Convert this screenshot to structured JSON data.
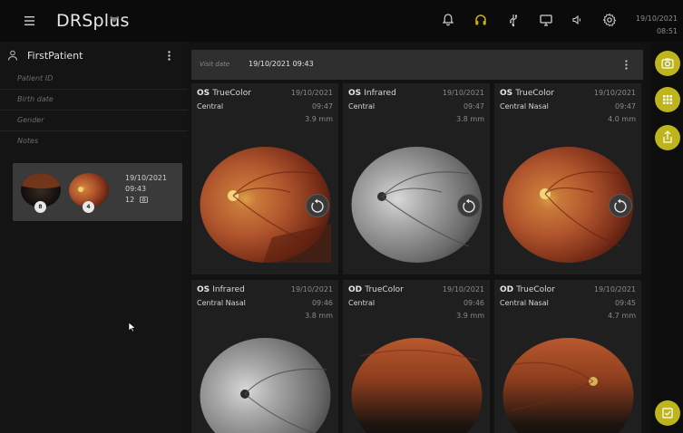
{
  "app": {
    "title": "DRSplus"
  },
  "topbar": {
    "date": "19/10/2021",
    "time": "08:51"
  },
  "patient": {
    "name": "FirstPatient",
    "fields": [
      "Patient ID",
      "Birth date",
      "Gender",
      "Notes"
    ]
  },
  "visit_card": {
    "date": "19/10/2021",
    "time": "09:43",
    "count": "12",
    "badge_left": "8",
    "badge_right": "4"
  },
  "visit_bar": {
    "label": "Visit date",
    "value": "19/10/2021 09:43"
  },
  "cards": [
    {
      "eye": "OS",
      "mode": "TrueColor",
      "region": "Central",
      "date": "19/10/2021",
      "time": "09:47",
      "size": "3.9 mm",
      "kind": "color"
    },
    {
      "eye": "OS",
      "mode": "Infrared",
      "region": "Central",
      "date": "19/10/2021",
      "time": "09:47",
      "size": "3.8 mm",
      "kind": "ir"
    },
    {
      "eye": "OS",
      "mode": "TrueColor",
      "region": "Central Nasal",
      "date": "19/10/2021",
      "time": "09:47",
      "size": "4.0 mm",
      "kind": "color"
    },
    {
      "eye": "OS",
      "mode": "Infrared",
      "region": "Central Nasal",
      "date": "19/10/2021",
      "time": "09:46",
      "size": "3.8 mm",
      "kind": "ir"
    },
    {
      "eye": "OD",
      "mode": "TrueColor",
      "region": "Central",
      "date": "19/10/2021",
      "time": "09:46",
      "size": "3.9 mm",
      "kind": "color-dark"
    },
    {
      "eye": "OD",
      "mode": "TrueColor",
      "region": "Central Nasal",
      "date": "19/10/2021",
      "time": "09:45",
      "size": "4.7 mm",
      "kind": "color-dark"
    }
  ],
  "colors": {
    "accent": "#bdb51b",
    "headphone_active": "#d4b200"
  },
  "icons": [
    "menu-icon",
    "bell-icon",
    "headphones-icon",
    "usb-icon",
    "monitor-icon",
    "speaker-icon",
    "gear-icon",
    "user-icon",
    "camera-icon",
    "grid-icon",
    "share-icon",
    "checklist-icon",
    "rotate-icon"
  ]
}
